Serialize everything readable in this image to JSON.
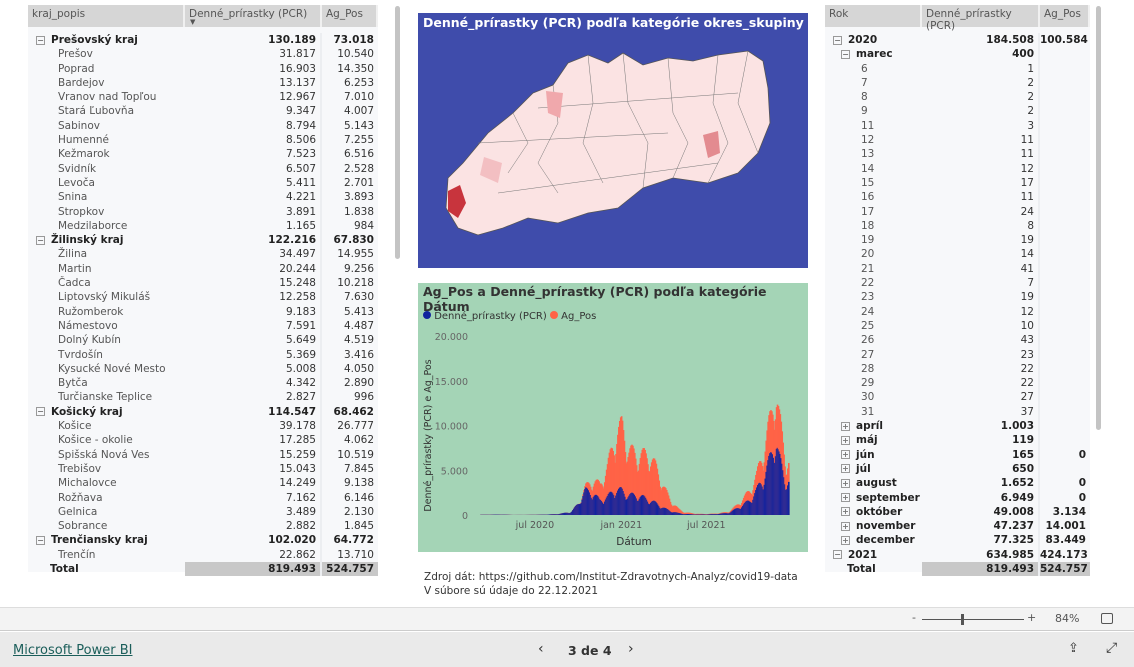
{
  "left_table": {
    "headers": [
      "kraj_popis",
      "Denné_prírastky (PCR)",
      "Ag_Pos"
    ],
    "rows": [
      {
        "n": "Prešovský kraj",
        "p": "130.189",
        "a": "73.018",
        "g": 1
      },
      {
        "n": "Prešov",
        "p": "31.817",
        "a": "10.540"
      },
      {
        "n": "Poprad",
        "p": "16.903",
        "a": "14.350"
      },
      {
        "n": "Bardejov",
        "p": "13.137",
        "a": "6.253"
      },
      {
        "n": "Vranov nad Topľou",
        "p": "12.967",
        "a": "7.010"
      },
      {
        "n": "Stará Ľubovňa",
        "p": "9.347",
        "a": "4.007"
      },
      {
        "n": "Sabinov",
        "p": "8.794",
        "a": "5.143"
      },
      {
        "n": "Humenné",
        "p": "8.506",
        "a": "7.255"
      },
      {
        "n": "Kežmarok",
        "p": "7.523",
        "a": "6.516"
      },
      {
        "n": "Svidník",
        "p": "6.507",
        "a": "2.528"
      },
      {
        "n": "Levoča",
        "p": "5.411",
        "a": "2.701"
      },
      {
        "n": "Snina",
        "p": "4.221",
        "a": "3.893"
      },
      {
        "n": "Stropkov",
        "p": "3.891",
        "a": "1.838"
      },
      {
        "n": "Medzilaborce",
        "p": "1.165",
        "a": "984"
      },
      {
        "n": "Žilinský kraj",
        "p": "122.216",
        "a": "67.830",
        "g": 1
      },
      {
        "n": "Žilina",
        "p": "34.497",
        "a": "14.955"
      },
      {
        "n": "Martin",
        "p": "20.244",
        "a": "9.256"
      },
      {
        "n": "Čadca",
        "p": "15.248",
        "a": "10.218"
      },
      {
        "n": "Liptovský Mikuláš",
        "p": "12.258",
        "a": "7.630"
      },
      {
        "n": "Ružomberok",
        "p": "9.183",
        "a": "5.413"
      },
      {
        "n": "Námestovo",
        "p": "7.591",
        "a": "4.487"
      },
      {
        "n": "Dolný Kubín",
        "p": "5.649",
        "a": "4.519"
      },
      {
        "n": "Tvrdošín",
        "p": "5.369",
        "a": "3.416"
      },
      {
        "n": "Kysucké Nové Mesto",
        "p": "5.008",
        "a": "4.050"
      },
      {
        "n": "Bytča",
        "p": "4.342",
        "a": "2.890"
      },
      {
        "n": "Turčianske Teplice",
        "p": "2.827",
        "a": "996"
      },
      {
        "n": "Košický kraj",
        "p": "114.547",
        "a": "68.462",
        "g": 1
      },
      {
        "n": "Košice",
        "p": "39.178",
        "a": "26.777"
      },
      {
        "n": "Košice - okolie",
        "p": "17.285",
        "a": "4.062"
      },
      {
        "n": "Spišská Nová Ves",
        "p": "15.259",
        "a": "10.519"
      },
      {
        "n": "Trebišov",
        "p": "15.043",
        "a": "7.845"
      },
      {
        "n": "Michalovce",
        "p": "14.249",
        "a": "9.138"
      },
      {
        "n": "Rožňava",
        "p": "7.162",
        "a": "6.146"
      },
      {
        "n": "Gelnica",
        "p": "3.489",
        "a": "2.130"
      },
      {
        "n": "Sobrance",
        "p": "2.882",
        "a": "1.845"
      },
      {
        "n": "Trenčiansky kraj",
        "p": "102.020",
        "a": "64.772",
        "g": 1
      },
      {
        "n": "Trenčín",
        "p": "22.862",
        "a": "13.710"
      },
      {
        "n": "Total",
        "p": "819.493",
        "a": "524.757",
        "t": 1
      }
    ]
  },
  "right_table": {
    "headers": [
      "Rok",
      "Denné_prírastky (PCR)",
      "Ag_Pos"
    ],
    "rows": [
      {
        "n": "2020",
        "p": "184.508",
        "a": "100.584",
        "l": 0,
        "tog": "⊟"
      },
      {
        "n": "marec",
        "p": "400",
        "a": "",
        "l": 1,
        "tog": "⊟"
      },
      {
        "n": "6",
        "p": "1",
        "l": 2
      },
      {
        "n": "7",
        "p": "2",
        "l": 2
      },
      {
        "n": "8",
        "p": "2",
        "l": 2
      },
      {
        "n": "9",
        "p": "2",
        "l": 2
      },
      {
        "n": "11",
        "p": "3",
        "l": 2
      },
      {
        "n": "12",
        "p": "11",
        "l": 2
      },
      {
        "n": "13",
        "p": "11",
        "l": 2
      },
      {
        "n": "14",
        "p": "12",
        "l": 2
      },
      {
        "n": "15",
        "p": "17",
        "l": 2
      },
      {
        "n": "16",
        "p": "11",
        "l": 2
      },
      {
        "n": "17",
        "p": "24",
        "l": 2
      },
      {
        "n": "18",
        "p": "8",
        "l": 2
      },
      {
        "n": "19",
        "p": "19",
        "l": 2
      },
      {
        "n": "20",
        "p": "14",
        "l": 2
      },
      {
        "n": "21",
        "p": "41",
        "l": 2
      },
      {
        "n": "22",
        "p": "7",
        "l": 2
      },
      {
        "n": "23",
        "p": "19",
        "l": 2
      },
      {
        "n": "24",
        "p": "12",
        "l": 2
      },
      {
        "n": "25",
        "p": "10",
        "l": 2
      },
      {
        "n": "26",
        "p": "43",
        "l": 2
      },
      {
        "n": "27",
        "p": "23",
        "l": 2
      },
      {
        "n": "28",
        "p": "22",
        "l": 2
      },
      {
        "n": "29",
        "p": "22",
        "l": 2
      },
      {
        "n": "30",
        "p": "27",
        "l": 2
      },
      {
        "n": "31",
        "p": "37",
        "l": 2
      },
      {
        "n": "apríl",
        "p": "1.003",
        "a": "",
        "l": 1,
        "tog": "⊞"
      },
      {
        "n": "máj",
        "p": "119",
        "a": "",
        "l": 1,
        "tog": "⊞"
      },
      {
        "n": "jún",
        "p": "165",
        "a": "0",
        "l": 1,
        "tog": "⊞"
      },
      {
        "n": "júl",
        "p": "650",
        "a": "",
        "l": 1,
        "tog": "⊞"
      },
      {
        "n": "august",
        "p": "1.652",
        "a": "0",
        "l": 1,
        "tog": "⊞"
      },
      {
        "n": "september",
        "p": "6.949",
        "a": "0",
        "l": 1,
        "tog": "⊞"
      },
      {
        "n": "október",
        "p": "49.008",
        "a": "3.134",
        "l": 1,
        "tog": "⊞"
      },
      {
        "n": "november",
        "p": "47.237",
        "a": "14.001",
        "l": 1,
        "tog": "⊞"
      },
      {
        "n": "december",
        "p": "77.325",
        "a": "83.449",
        "l": 1,
        "tog": "⊞"
      },
      {
        "n": "2021",
        "p": "634.985",
        "a": "424.173",
        "l": 0,
        "tog": "⊟"
      },
      {
        "n": "Total",
        "p": "819.493",
        "a": "524.757",
        "t": 1
      }
    ]
  },
  "map": {
    "title": "Denné_prírastky (PCR) podľa kategórie okres_skupiny",
    "bg": "#3f4cab"
  },
  "chart_data": {
    "type": "bar",
    "stacked": true,
    "title": "Ag_Pos a Denné_prírastky (PCR) podľa kategórie Dátum",
    "xlabel": "Dátum",
    "ylabel": "Denné_prírastky (PCR) e Ag_Pos",
    "ylim": [
      0,
      20000
    ],
    "yticks": [
      "0",
      "5.000",
      "10.000",
      "15.000",
      "20.000"
    ],
    "xticks": [
      {
        "label": "jul 2020",
        "date": "2020-07-01"
      },
      {
        "label": "jan 2021",
        "date": "2021-01-01"
      },
      {
        "label": "jul 2021",
        "date": "2021-07-01"
      }
    ],
    "xlim": [
      "2020-03-06",
      "2021-12-22"
    ],
    "legend_position": "top-left",
    "series": [
      {
        "name": "Denné_prírastky (PCR)",
        "color": "#12239e"
      },
      {
        "name": "Ag_Pos",
        "color": "#ff6347"
      }
    ],
    "x": [
      "2020-03-15",
      "2020-04-15",
      "2020-05-15",
      "2020-06-15",
      "2020-07-15",
      "2020-08-15",
      "2020-09-15",
      "2020-10-01",
      "2020-10-15",
      "2020-11-01",
      "2020-11-15",
      "2020-12-01",
      "2020-12-15",
      "2021-01-01",
      "2021-01-15",
      "2021-02-01",
      "2021-02-15",
      "2021-03-01",
      "2021-03-15",
      "2021-04-01",
      "2021-04-15",
      "2021-05-01",
      "2021-05-15",
      "2021-06-15",
      "2021-07-15",
      "2021-08-15",
      "2021-09-01",
      "2021-09-15",
      "2021-10-01",
      "2021-10-15",
      "2021-11-01",
      "2021-11-15",
      "2021-11-25",
      "2021-12-01",
      "2021-12-15"
    ],
    "pcr": [
      20,
      40,
      5,
      10,
      30,
      80,
      300,
      1200,
      2500,
      2200,
      1500,
      1800,
      2500,
      2500,
      2000,
      2000,
      1800,
      1500,
      1200,
      700,
      400,
      200,
      100,
      50,
      80,
      200,
      600,
      1000,
      1500,
      2500,
      4000,
      6000,
      8000,
      6000,
      3500
    ],
    "ag": [
      0,
      0,
      0,
      0,
      0,
      0,
      0,
      0,
      300,
      1300,
      1500,
      3000,
      5000,
      6500,
      4500,
      4000,
      4200,
      4500,
      3500,
      2000,
      1000,
      400,
      150,
      50,
      40,
      100,
      300,
      600,
      1000,
      1500,
      3000,
      4000,
      5000,
      4000,
      2000
    ]
  },
  "source": {
    "line1": "Zdroj dát: https://github.com/Institut-Zdravotnych-Analyz/covid19-data",
    "line2": "V súbore sú údaje do 22.12.2021"
  },
  "zoom": {
    "minus": "-",
    "plus": "+",
    "level": "84%"
  },
  "footer": {
    "brand": "Microsoft Power BI",
    "page": "3 de 4"
  }
}
